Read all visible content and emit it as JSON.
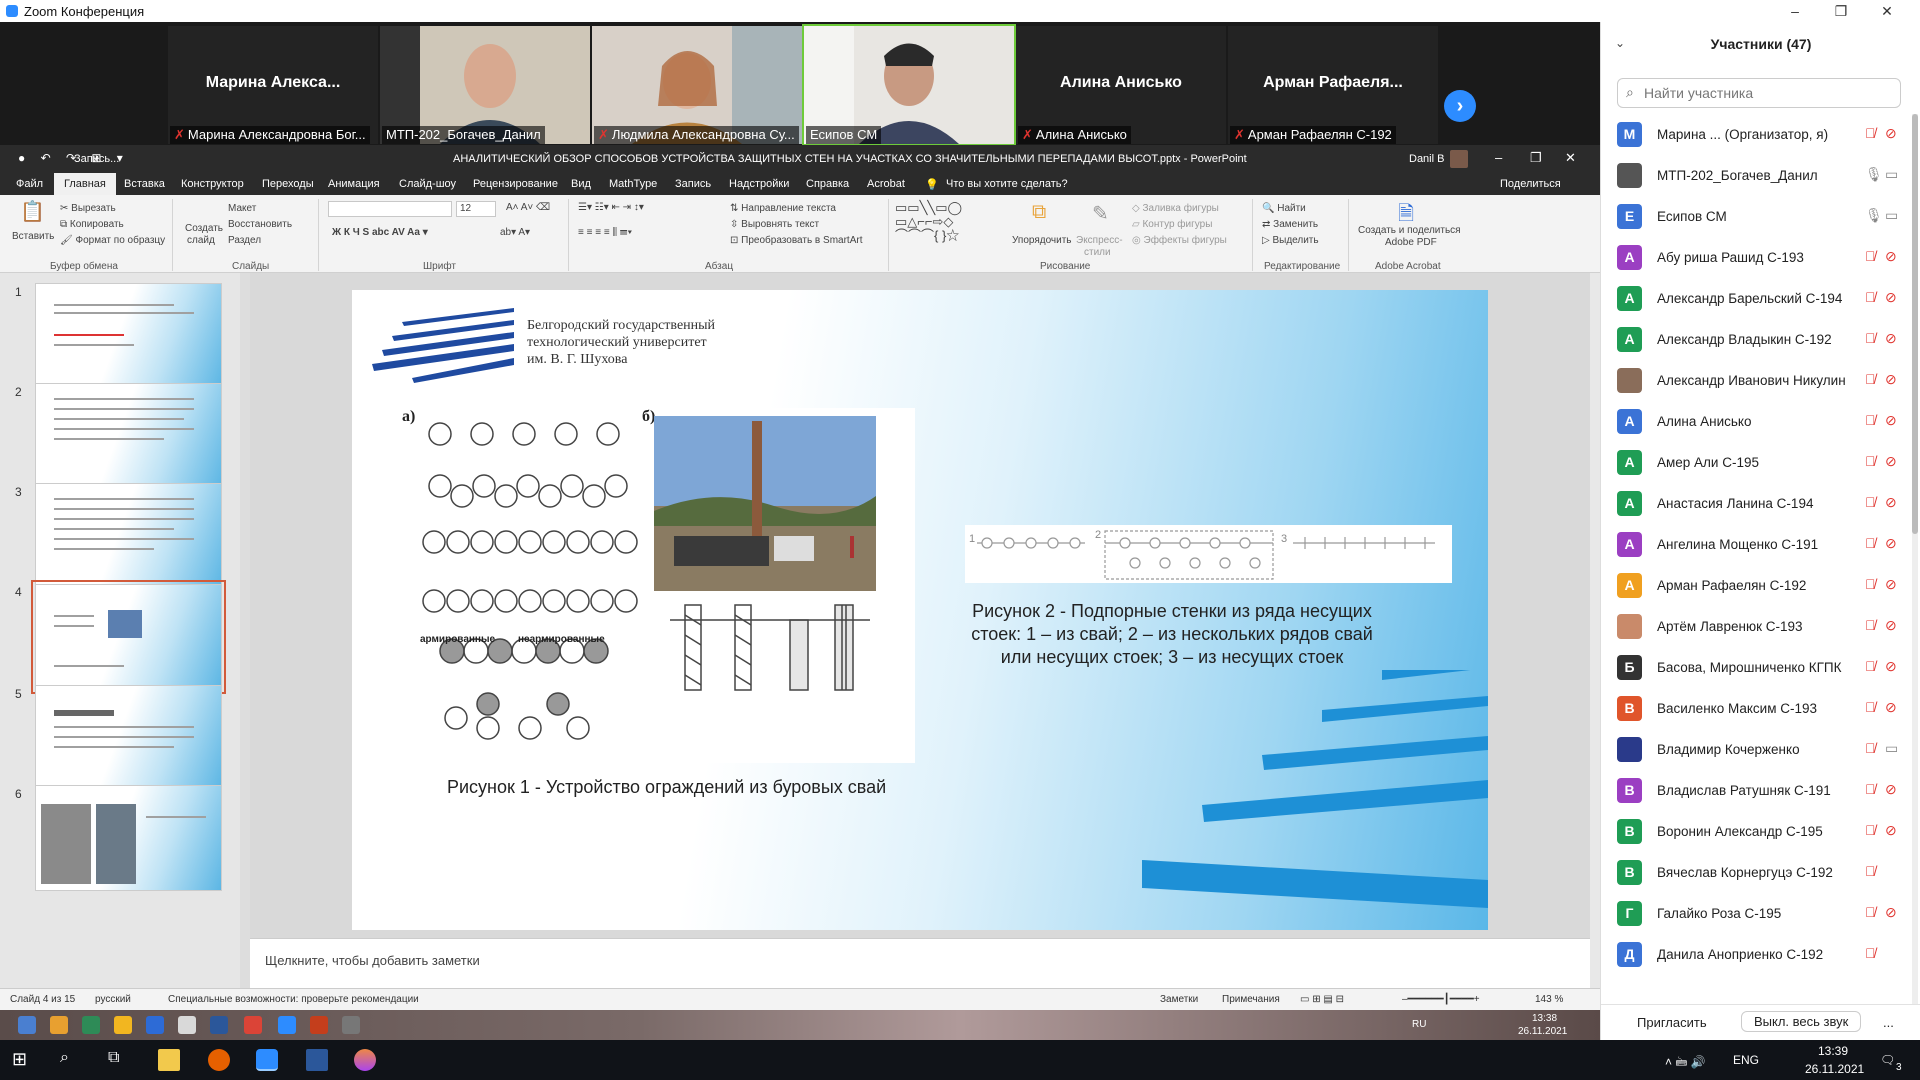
{
  "window": {
    "title": "Zoom Конференция",
    "controls": [
      "–",
      "❐",
      "✕"
    ]
  },
  "gallery": {
    "tiles": [
      {
        "name": "Марина Алекса...",
        "caption": "Марина Александровна Бог...",
        "muted": true,
        "video": false
      },
      {
        "name": "",
        "caption": "МТП-202_Богачев_Данил",
        "muted": false,
        "video": true
      },
      {
        "name": "",
        "caption": "Людмила Александровна Су...",
        "muted": true,
        "video": true
      },
      {
        "name": "",
        "caption": "Есипов СМ",
        "muted": false,
        "video": true,
        "active": true
      },
      {
        "name": "Алина Анисько",
        "caption": "Алина Анисько",
        "muted": true,
        "video": false
      },
      {
        "name": "Арман Рафаеля...",
        "caption": "Арман Рафаелян С-192",
        "muted": true,
        "video": false
      }
    ],
    "next_icon": "chevron-right-icon"
  },
  "ppt": {
    "quick_access": "Запись...",
    "doc_title": "АНАЛИТИЧЕСКИЙ ОБЗОР СПОСОБОВ УСТРОЙСТВА ЗАЩИТНЫХ СТЕН НА УЧАСТКАХ СО ЗНАЧИТЕЛЬНЫМИ ПЕРЕПАДАМИ ВЫСОТ.pptx - PowerPoint",
    "user": "Danil B",
    "tabs": [
      "Файл",
      "Главная",
      "Вставка",
      "Конструктор",
      "Переходы",
      "Анимация",
      "Слайд-шоу",
      "Рецензирование",
      "Вид",
      "MathType",
      "Запись",
      "Надстройки",
      "Справка",
      "Acrobat"
    ],
    "active_tab": "Главная",
    "tell_me": "Что вы хотите сделать?",
    "share": "Поделиться",
    "ribbon": {
      "paste": "Вставить",
      "cut": "Вырезать",
      "copy": "Копировать",
      "format_painter": "Формат по образцу",
      "new_slide_1": "Создать",
      "new_slide_2": "слайд",
      "layout": "Макет",
      "reset": "Восстановить",
      "section": "Раздел",
      "font_size": "12",
      "text_direction": "Направление текста",
      "align_text": "Выровнять текст",
      "smartart": "Преобразовать в SmartArt",
      "arrange": "Упорядочить",
      "quick_styles_1": "Экспресс-",
      "quick_styles_2": "стили",
      "shape_fill": "Заливка фигуры",
      "shape_outline": "Контур фигуры",
      "shape_effects": "Эффекты фигуры",
      "find": "Найти",
      "replace": "Заменить",
      "select": "Выделить",
      "acrobat_1": "Создать и поделиться",
      "acrobat_2": "Adobe PDF",
      "groups": [
        "Буфер обмена",
        "Слайды",
        "Шрифт",
        "Абзац",
        "Рисование",
        "Редактирование",
        "Adobe Acrobat"
      ]
    },
    "thumbnails": [
      {
        "num": "1"
      },
      {
        "num": "2"
      },
      {
        "num": "3"
      },
      {
        "num": "4",
        "selected": true
      },
      {
        "num": "5"
      },
      {
        "num": "6"
      }
    ],
    "slide": {
      "university_line1": "Белгородский государственный",
      "university_line2": "технологический университет",
      "university_line3": "им. В. Г. Шухова",
      "fig1_a": "а)",
      "fig1_b": "б)",
      "fig1_reinforced": "армированные",
      "fig1_unreinforced": "неармированные",
      "caption1": "Рисунок 1 - Устройство ограждений из буровых свай",
      "caption2": "Рисунок 2 - Подпорные стенки из ряда несущих стоек: 1 – из свай; 2 – из нескольких рядов свай или несущих стоек; 3 – из несущих стоек",
      "fig2_labels": [
        "1",
        "2",
        "3"
      ]
    },
    "notes_placeholder": "Щелкните, чтобы добавить заметки",
    "status": {
      "slide_of": "Слайд 4 из 15",
      "language": "русский",
      "accessibility": "Специальные возможности: проверьте рекомендации",
      "notes": "Заметки",
      "comments": "Примечания",
      "zoom": "143 %"
    },
    "inner_taskbar": {
      "lang": "RU",
      "time": "13:38",
      "date": "26.11.2021"
    }
  },
  "participants": {
    "title": "Участники (47)",
    "search_placeholder": "Найти участника",
    "list": [
      {
        "initial": "М",
        "name": "Марина ... (Организатор, я)",
        "color": "#3b73d6",
        "mic": "muted",
        "cam": "off"
      },
      {
        "initial": "",
        "name": "МТП-202_Богачев_Данил",
        "color": "#555555",
        "photo": true,
        "mic": "on",
        "cam": "on"
      },
      {
        "initial": "Е",
        "name": "Есипов СМ",
        "color": "#3b73d6",
        "mic": "on",
        "cam": "on"
      },
      {
        "initial": "А",
        "name": "Абу риша Рашид С-193",
        "color": "#9b3fc2",
        "mic": "muted",
        "cam": "off"
      },
      {
        "initial": "А",
        "name": "Александр Барельский С-194",
        "color": "#1f9d55",
        "mic": "muted",
        "cam": "off"
      },
      {
        "initial": "А",
        "name": "Александр Владыкин С-192",
        "color": "#1f9d55",
        "mic": "muted",
        "cam": "off"
      },
      {
        "initial": "",
        "name": "Александр Иванович Никулин",
        "color": "#8a6d5a",
        "photo": true,
        "mic": "muted",
        "cam": "off"
      },
      {
        "initial": "А",
        "name": "Алина Анисько",
        "color": "#3b73d6",
        "mic": "muted",
        "cam": "off"
      },
      {
        "initial": "А",
        "name": "Амер Али С-195",
        "color": "#1f9d55",
        "mic": "muted",
        "cam": "off"
      },
      {
        "initial": "А",
        "name": "Анастасия Ланина С-194",
        "color": "#1f9d55",
        "mic": "muted",
        "cam": "off"
      },
      {
        "initial": "А",
        "name": "Ангелина Мощенко С-191",
        "color": "#9b3fc2",
        "mic": "muted",
        "cam": "off"
      },
      {
        "initial": "А",
        "name": "Арман Рафаелян С-192",
        "color": "#f0a020",
        "mic": "muted",
        "cam": "off"
      },
      {
        "initial": "",
        "name": "Артём Лавренюк С-193",
        "color": "#c98a6a",
        "photo": true,
        "mic": "muted",
        "cam": "off"
      },
      {
        "initial": "Б",
        "name": "Басова, Мирошниченко КГПК",
        "color": "#333333",
        "mic": "muted",
        "cam": "off"
      },
      {
        "initial": "В",
        "name": "Василенко Максим С-193",
        "color": "#e0552b",
        "mic": "muted",
        "cam": "off"
      },
      {
        "initial": "",
        "name": "Владимир Кочерженко",
        "color": "#2a3a8a",
        "photo": true,
        "mic": "muted",
        "cam": "on"
      },
      {
        "initial": "В",
        "name": "Владислав Ратушняк С-191",
        "color": "#9b3fc2",
        "mic": "muted",
        "cam": "off"
      },
      {
        "initial": "В",
        "name": "Воронин Александр С-195",
        "color": "#1f9d55",
        "mic": "muted",
        "cam": "off"
      },
      {
        "initial": "В",
        "name": "Вячеслав Корнергуцэ С-192",
        "color": "#1f9d55",
        "mic": "muted",
        "cam": "none"
      },
      {
        "initial": "Г",
        "name": "Галайко Роза С-195",
        "color": "#1f9d55",
        "mic": "muted",
        "cam": "off"
      },
      {
        "initial": "Д",
        "name": "Данила Аноприенко С-192",
        "color": "#3b73d6",
        "mic": "muted",
        "cam": "none"
      }
    ],
    "invite": "Пригласить",
    "mute_all": "Выкл. весь звук",
    "more": "..."
  },
  "taskbar": {
    "lang": "ENG",
    "time": "13:39",
    "date": "26.11.2021",
    "notif": "3"
  }
}
